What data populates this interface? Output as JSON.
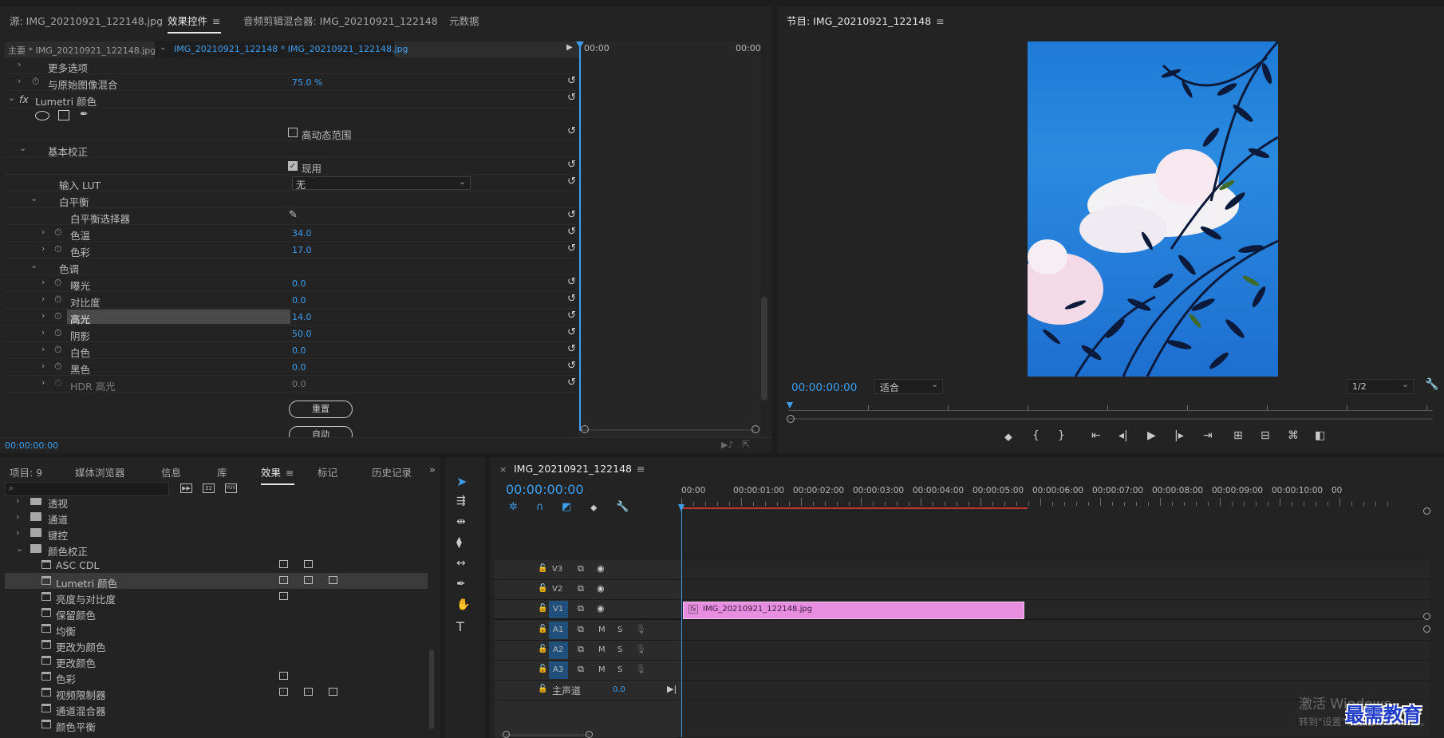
{
  "top_tabs": {
    "source": "源: IMG_20210921_122148.jpg",
    "effect_controls": "效果控件",
    "audio_mixer": "音频剪辑混合器: IMG_20210921_122148",
    "metadata": "元数据",
    "menu_glyph": "≡"
  },
  "ec": {
    "master": "主要 * IMG_20210921_122148.jpg",
    "clip": "IMG_20210921_122148 * IMG_20210921_122148.jpg",
    "time_start": "00:00",
    "time_end": "00:00",
    "more_options": "更多选项",
    "blend_label": "与原始图像混合",
    "blend_value": "75.0 %",
    "fx_glyph": "fx",
    "lumetri_label": "Lumetri 颜色",
    "hdr_range": "高动态范围",
    "basic_correction": "基本校正",
    "enable": "现用",
    "input_lut": "输入 LUT",
    "input_lut_value": "无",
    "white_balance": "白平衡",
    "wb_picker": "白平衡选择器",
    "temperature": "色温",
    "temperature_value": "34.0",
    "tint": "色彩",
    "tint_value": "17.0",
    "tone": "色调",
    "exposure": "曝光",
    "exposure_value": "0.0",
    "contrast": "对比度",
    "contrast_value": "0.0",
    "highlights": "高光",
    "highlights_value": "14.0",
    "shadows": "阴影",
    "shadows_value": "50.0",
    "whites": "白色",
    "whites_value": "0.0",
    "blacks": "黑色",
    "blacks_value": "0.0",
    "hdr_highlights": "HDR 高光",
    "hdr_highlights_value": "0.0",
    "reset_btn": "重置",
    "auto_btn": "自动",
    "timecode": "00:00:00:00"
  },
  "program": {
    "title": "节目: IMG_20210921_122148",
    "timecode": "00:00:00:00",
    "fit": "适合",
    "resolution": "1/2"
  },
  "project_tabs": {
    "project": "项目: 9",
    "media_browser": "媒体浏览器",
    "info": "信息",
    "library": "库",
    "effects": "效果",
    "markers": "标记",
    "history": "历史记录",
    "more": "»"
  },
  "effects_list": [
    {
      "label": "透视",
      "type": "folder",
      "open": false
    },
    {
      "label": "通道",
      "type": "folder",
      "open": false
    },
    {
      "label": "键控",
      "type": "folder",
      "open": false
    },
    {
      "label": "颜色校正",
      "type": "folder",
      "open": true
    },
    {
      "label": "ASC CDL",
      "type": "effect"
    },
    {
      "label": "Lumetri 颜色",
      "type": "effect"
    },
    {
      "label": "亮度与对比度",
      "type": "effect"
    },
    {
      "label": "保留颜色",
      "type": "effect"
    },
    {
      "label": "均衡",
      "type": "effect"
    },
    {
      "label": "更改为颜色",
      "type": "effect"
    },
    {
      "label": "更改颜色",
      "type": "effect"
    },
    {
      "label": "色彩",
      "type": "effect"
    },
    {
      "label": "视频限制器",
      "type": "effect"
    },
    {
      "label": "通道混合器",
      "type": "effect"
    },
    {
      "label": "颜色平衡",
      "type": "effect"
    }
  ],
  "timeline": {
    "tab": "IMG_20210921_122148",
    "close": "×",
    "timecode": "00:00:00:00",
    "ruler": [
      "00:00",
      "00:00:01:00",
      "00:00:02:00",
      "00:00:03:00",
      "00:00:04:00",
      "00:00:05:00",
      "00:00:06:00",
      "00:00:07:00",
      "00:00:08:00",
      "00:00:09:00",
      "00:00:10:00",
      "00"
    ],
    "tracks": {
      "v3": "V3",
      "v2": "V2",
      "v1": "V1",
      "a1": "A1",
      "a2": "A2",
      "a3": "A3",
      "m": "M",
      "s": "S",
      "master": "主声道",
      "master_value": "0.0"
    },
    "clip_name": "IMG_20210921_122148.jpg",
    "clip_fx": "fx"
  },
  "watermark": {
    "activate": "激活 Windows",
    "goto": "转到\"设置\"以激活 Windows。",
    "brand": "最需教育"
  },
  "colors": {
    "accent": "#3d9ff0",
    "clip_pink": "#e88ee0",
    "work_area_red": "#c0392b",
    "track_blue": "#1f4f7a"
  },
  "icons": {
    "stopwatch": "⏱",
    "reset": "↺",
    "eye": "◉",
    "lock": "🔓"
  }
}
